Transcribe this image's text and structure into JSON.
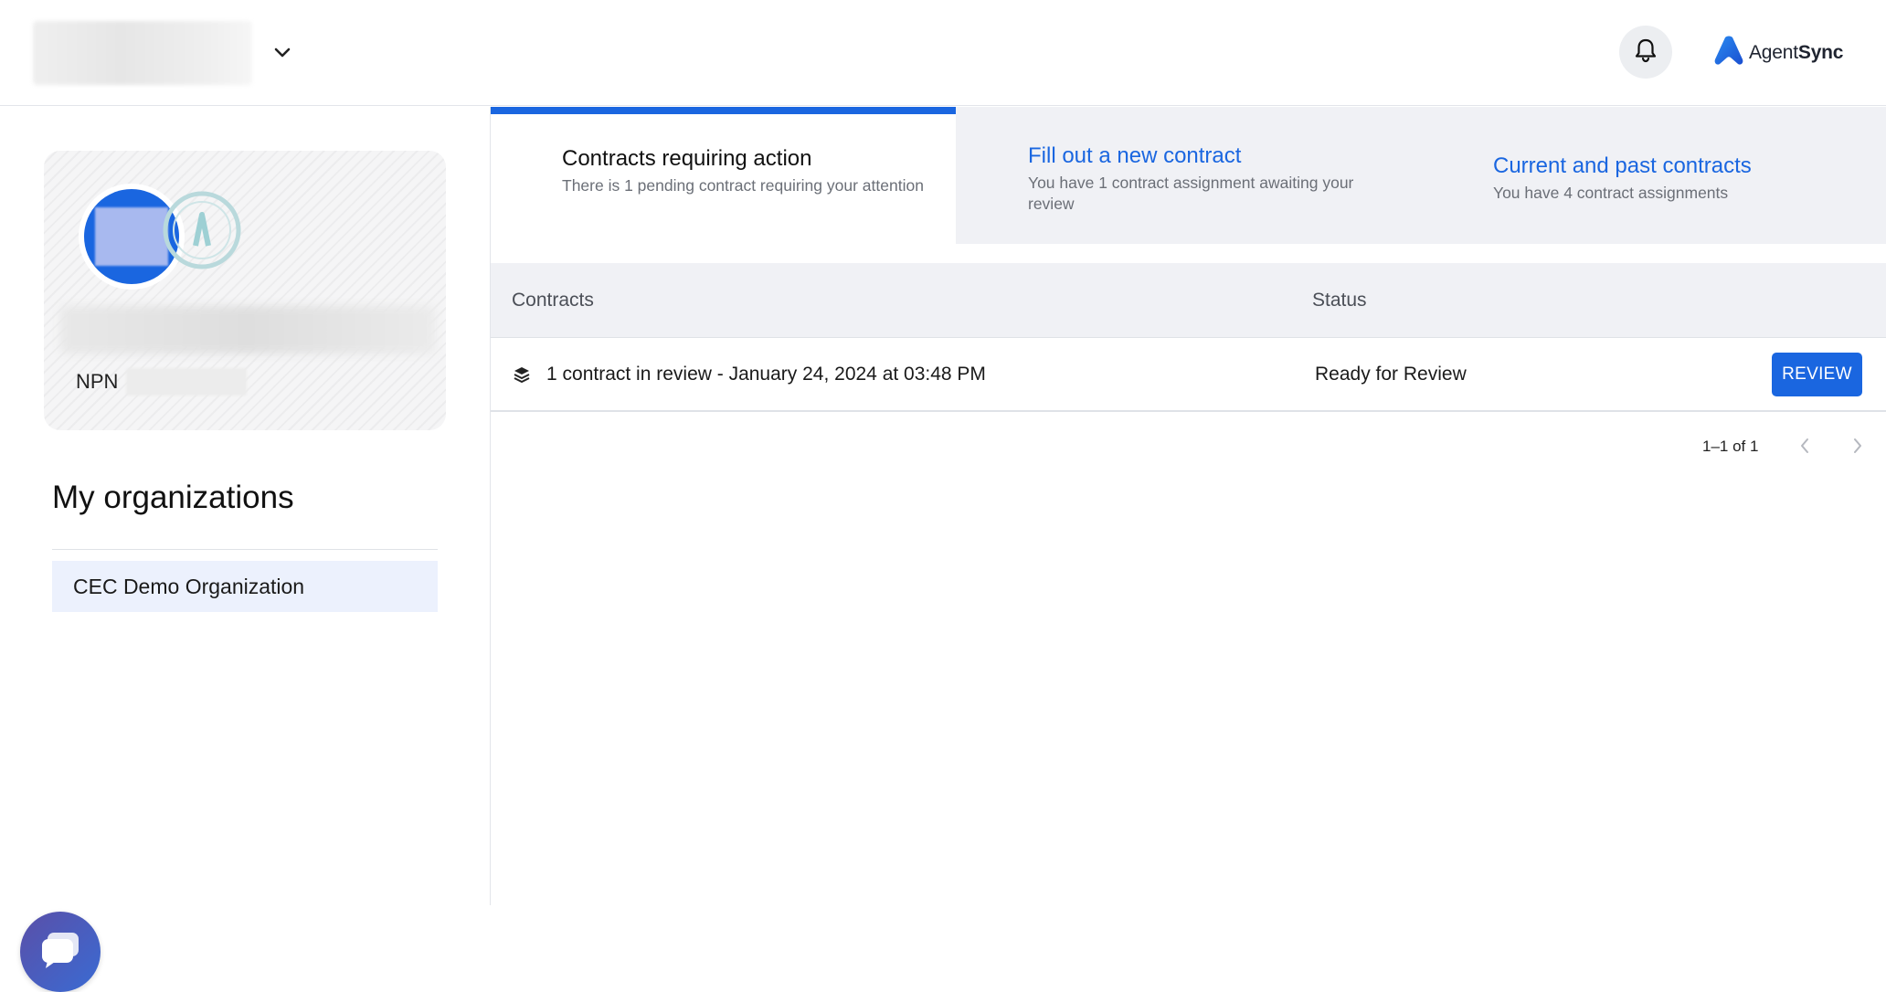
{
  "brand": {
    "name_prefix": "Agent",
    "name_suffix": "Sync",
    "accent": "#1a66e0"
  },
  "header": {
    "org_switcher_icon": "chevron-down-icon",
    "notifications_icon": "bell-icon"
  },
  "profile": {
    "npn_label": "NPN"
  },
  "organizations": {
    "title": "My organizations",
    "items": [
      {
        "label": "CEC Demo Organization"
      }
    ]
  },
  "tabs": [
    {
      "title": "Contracts requiring action",
      "subtitle": "There is 1 pending contract requiring your attention",
      "active": true
    },
    {
      "title": "Fill out a new contract",
      "subtitle": "You have 1 contract assignment awaiting your review",
      "active": false
    },
    {
      "title": "Current and past contracts",
      "subtitle": "You have 4 contract assignments",
      "active": false
    }
  ],
  "table": {
    "columns": [
      "Contracts",
      "Status"
    ],
    "rows": [
      {
        "icon": "layers-icon",
        "contract": "1 contract in review - January 24, 2024 at 03:48 PM",
        "status": "Ready for Review",
        "action": "REVIEW"
      }
    ]
  },
  "pagination": {
    "range": "1–1 of 1"
  },
  "chat": {
    "icon": "chat-bubble-icon"
  }
}
